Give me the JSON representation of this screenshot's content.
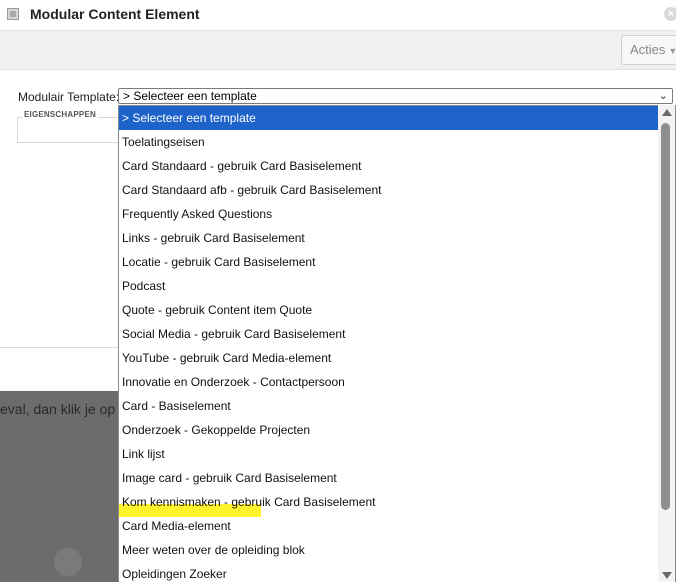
{
  "window": {
    "title": "Modular Content Element",
    "close_glyph": "×"
  },
  "toolbar": {
    "acties_label": "Acties"
  },
  "form": {
    "template_label": "Modulair Template:",
    "select_value": "> Selecteer een template",
    "fieldset_legend": "EIGENSCHAPPEN"
  },
  "background": {
    "overlay_text": "eval, dan klik je op"
  },
  "dropdown": {
    "options": [
      "> Selecteer een template",
      "Toelatingseisen",
      "Card Standaard - gebruik Card Basiselement",
      "Card Standaard afb - gebruik Card Basiselement",
      "Frequently Asked Questions",
      "Links - gebruik Card Basiselement",
      "Locatie - gebruik Card Basiselement",
      "Podcast",
      "Quote - gebruik Content item Quote",
      "Social Media - gebruik Card Basiselement",
      "YouTube - gebruik Card Media-element",
      "Innovatie en Onderzoek - Contactpersoon",
      "Card - Basiselement",
      "Onderzoek - Gekoppelde Projecten",
      "Link lijst",
      "Image card - gebruik Card Basiselement",
      "Kom kennismaken - gebruik Card Basiselement",
      "Card Media-element",
      "Meer weten over de opleiding blok",
      "Opleidingen Zoeker"
    ],
    "selected_index": 0,
    "highlighted_index": 12
  },
  "colors": {
    "selection": "#1e63c9",
    "highlight": "#fff32b",
    "overlay": "#6c6c6c"
  }
}
